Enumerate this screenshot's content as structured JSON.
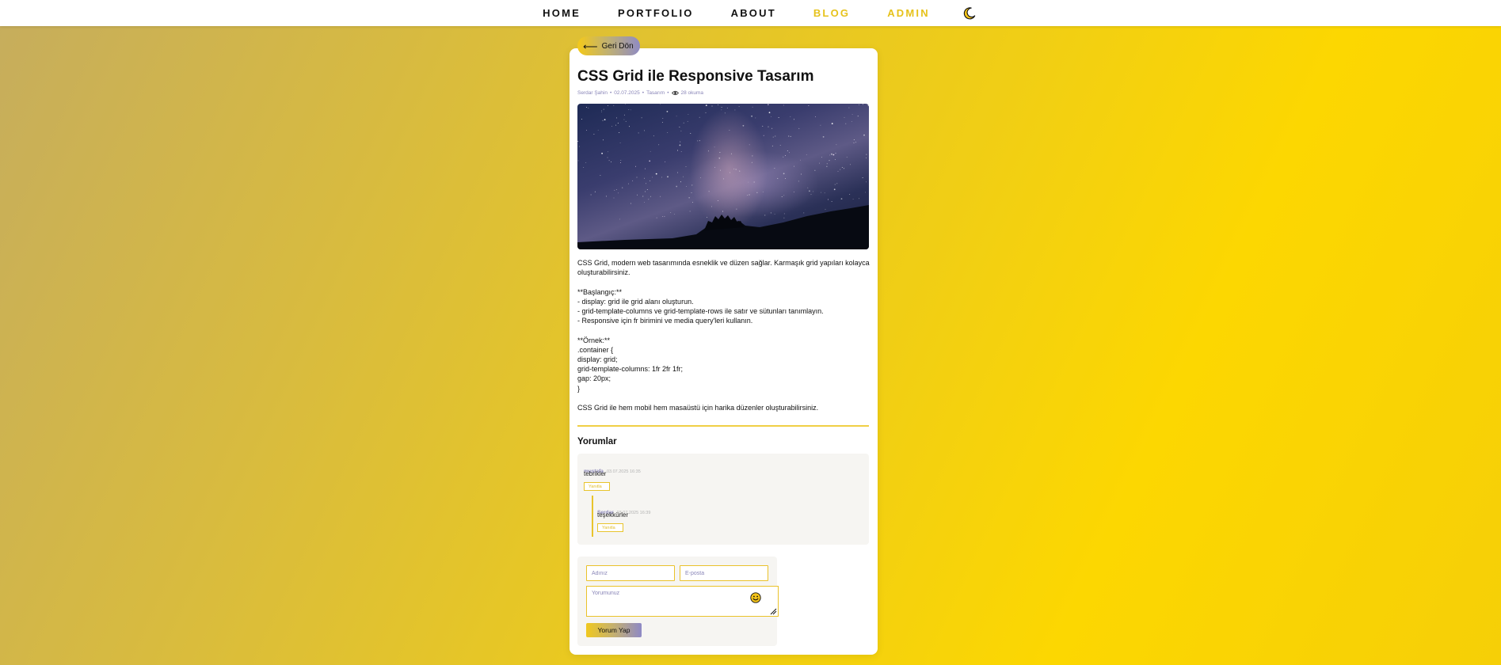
{
  "nav": {
    "items": [
      {
        "label": "HOME",
        "accent": false
      },
      {
        "label": "PORTFOLIO",
        "accent": false
      },
      {
        "label": "ABOUT",
        "accent": false
      },
      {
        "label": "BLOG",
        "accent": true
      },
      {
        "label": "ADMIN",
        "accent": true
      }
    ],
    "theme_toggle_icon": "moon-icon"
  },
  "back_button": {
    "arrow": "⟵",
    "label": "Geri Dön"
  },
  "post": {
    "title": "CSS Grid ile Responsive Tasarım",
    "meta": {
      "author": "Serdar Şahin",
      "date": "02.07.2025",
      "category": "Tasarım",
      "views": "28 okuma",
      "separator": "•"
    },
    "image_icon": "milky-way-image",
    "paragraphs": [
      "CSS Grid, modern web tasarımında esneklik ve düzen sağlar. Karmaşık grid yapıları kolayca oluşturabilirsiniz.",
      "",
      "**Başlangıç:**",
      "- display: grid ile grid alanı oluşturun.",
      "- grid-template-columns ve grid-template-rows ile satır ve sütunları tanımlayın.",
      "- Responsive için fr birimini ve media query'leri kullanın.",
      "",
      "**Örnek:**",
      ".container {",
      "display: grid;",
      "grid-template-columns: 1fr 2fr 1fr;",
      "gap: 20px;",
      "}",
      "",
      "CSS Grid ile hem mobil hem masaüstü için harika düzenler oluşturabilirsiniz."
    ]
  },
  "comments": {
    "title": "Yorumlar",
    "items": [
      {
        "author": "mustafa",
        "date": "03.07.2025 16:35",
        "text": "tebrikler",
        "reply_label": "Yanıtla"
      },
      {
        "author": "Serdar",
        "date": "03.07.2025 16:39",
        "text": "teşekkürler",
        "reply_label": "Yanıtla"
      }
    ]
  },
  "form": {
    "name_placeholder": "Adınız",
    "email_placeholder": "E-posta",
    "comment_placeholder": "Yorumunuz",
    "emoji_icon": "smiley-icon",
    "submit_label": "Yorum Yap"
  },
  "colors": {
    "accent_yellow": "#e6c21b",
    "accent_purple": "#8a86b8",
    "divider": "#f0cf45"
  }
}
